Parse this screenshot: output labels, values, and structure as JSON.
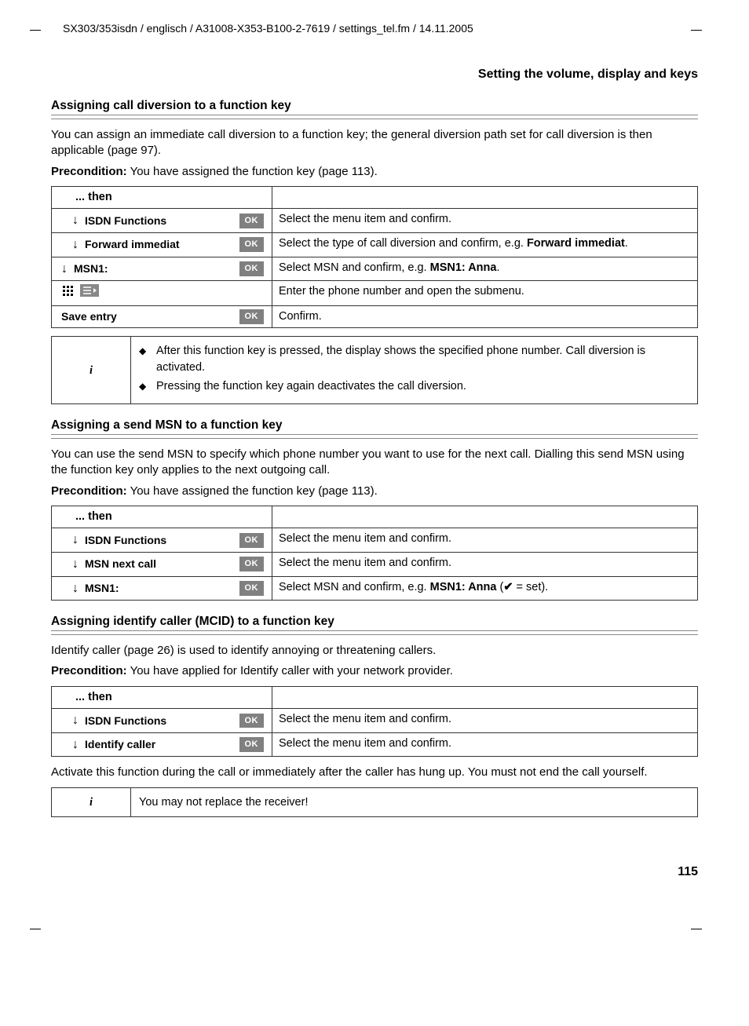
{
  "header_path": "SX303/353isdn / englisch / A31008-X353-B100-2-7619 / settings_tel.fm / 14.11.2005",
  "section_title": "Setting the volume, display and keys",
  "page_number": "115",
  "ok_label": "OK",
  "info_symbol": "i",
  "s1": {
    "heading": "Assigning call diversion to a function key",
    "intro": "You can assign an immediate call diversion to a function key; the general diversion path set for call diversion is then applicable (page 97).",
    "precond_label": "Precondition:",
    "precond_text": " You have assigned the function key (page 113).",
    "then": "... then",
    "rows": [
      {
        "label": "ISDN Functions",
        "desc": "Select the menu item and confirm.",
        "arrow": true,
        "ok": true,
        "indent": true
      },
      {
        "label": "Forward immediat",
        "desc_pre": "Select the type of call diversion and confirm, e.g. ",
        "desc_bold": "Forward immediat",
        "desc_post": ".",
        "arrow": true,
        "ok": true,
        "indent": true
      },
      {
        "label": "MSN1:",
        "desc_pre": "Select MSN and confirm, e.g. ",
        "desc_bold": "MSN1: Anna",
        "desc_post": ".",
        "arrow": true,
        "ok": true,
        "indent": false
      },
      {
        "special": "keypad",
        "desc": "Enter the phone number and open the submenu."
      },
      {
        "label": "Save entry",
        "desc": "Confirm.",
        "arrow": false,
        "ok": true,
        "indent": false
      }
    ],
    "info_bullets": [
      "After this function key is pressed, the display shows the specified phone number. Call diversion is activated.",
      "Pressing the function key again deactivates the call diversion."
    ]
  },
  "s2": {
    "heading": "Assigning a send MSN to a function key",
    "intro": "You can use the send MSN to specify which phone number you want to use for the next call. Dialling this send MSN using the function key only applies to the next outgoing call.",
    "precond_label": "Precondition:",
    "precond_text": " You have assigned the function key (page 113).",
    "then": "... then",
    "rows": [
      {
        "label": "ISDN Functions",
        "desc": "Select the menu item and confirm."
      },
      {
        "label": "MSN next call",
        "desc": "Select the menu item and confirm."
      },
      {
        "label": "MSN1:",
        "desc_pre": "Select MSN and confirm, e.g. ",
        "desc_bold": "MSN1: Anna",
        "desc_post_pre": " (",
        "desc_check": "✔",
        "desc_post": " = set)."
      }
    ]
  },
  "s3": {
    "heading": "Assigning identify caller (MCID) to a function key",
    "intro": "Identify caller (page 26) is used to identify annoying or threatening callers.",
    "precond_label": "Precondition:",
    "precond_text": " You have applied for Identify caller with your network provider.",
    "then": "... then",
    "rows": [
      {
        "label": "ISDN Functions",
        "desc": "Select the menu item and confirm."
      },
      {
        "label": "Identify caller",
        "desc": "Select the menu item and confirm."
      }
    ],
    "outro": "Activate this function during the call or immediately after the caller has hung up. You must not end the call yourself.",
    "info_text": "You may not replace the receiver!"
  }
}
